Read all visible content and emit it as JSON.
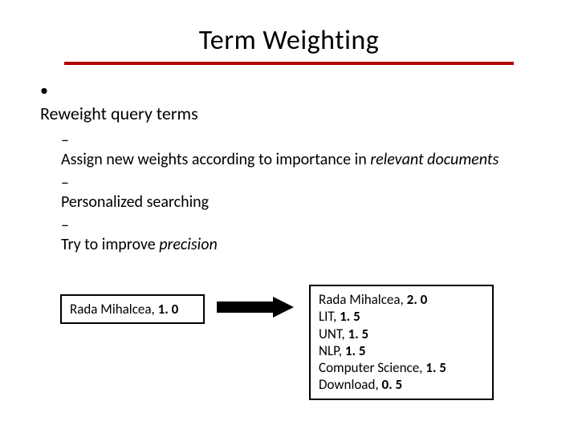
{
  "title": "Term Weighting",
  "bullet_main": "Reweight query terms",
  "subbullets": {
    "a_pre": "Assign new weights according to importance in ",
    "a_em": "relevant documents",
    "b": "Personalized searching",
    "c_pre": "Try to improve ",
    "c_em": "precision"
  },
  "left_box": {
    "term": "Rada Mihalcea, ",
    "weight": "1. 0"
  },
  "right_box": {
    "rows": [
      {
        "term": "Rada Mihalcea, ",
        "weight": "2. 0"
      },
      {
        "term": "LIT, ",
        "weight": "1. 5"
      },
      {
        "term": "UNT, ",
        "weight": "1. 5"
      },
      {
        "term": "NLP, ",
        "weight": "1. 5"
      },
      {
        "term": "Computer Science, ",
        "weight": "1. 5"
      },
      {
        "term": "Download, ",
        "weight": "0. 5"
      }
    ]
  }
}
